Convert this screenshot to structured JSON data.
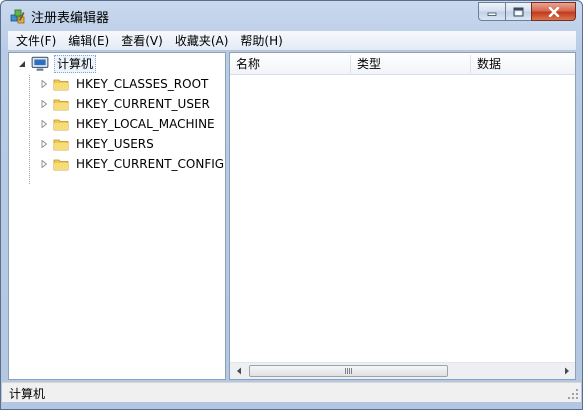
{
  "window": {
    "title": "注册表编辑器",
    "icons": {
      "app": "registry-editor-icon",
      "minimize": "minimize-icon",
      "maximize": "maximize-icon",
      "close": "close-icon"
    }
  },
  "menu": {
    "items": [
      "文件(F)",
      "编辑(E)",
      "查看(V)",
      "收藏夹(A)",
      "帮助(H)"
    ]
  },
  "tree": {
    "root": {
      "label": "计算机",
      "icon": "computer-icon",
      "expanded": true,
      "selected": true
    },
    "children": [
      {
        "label": "HKEY_CLASSES_ROOT",
        "icon": "folder-icon"
      },
      {
        "label": "HKEY_CURRENT_USER",
        "icon": "folder-icon"
      },
      {
        "label": "HKEY_LOCAL_MACHINE",
        "icon": "folder-icon"
      },
      {
        "label": "HKEY_USERS",
        "icon": "folder-icon"
      },
      {
        "label": "HKEY_CURRENT_CONFIG",
        "icon": "folder-icon"
      }
    ]
  },
  "list": {
    "columns": [
      "名称",
      "类型",
      "数据"
    ],
    "rows": []
  },
  "status": {
    "path": "计算机"
  },
  "colors": {
    "frame": "#b9cce6",
    "close_button": "#c33a1f",
    "selection_border": "#8aa2c6"
  }
}
